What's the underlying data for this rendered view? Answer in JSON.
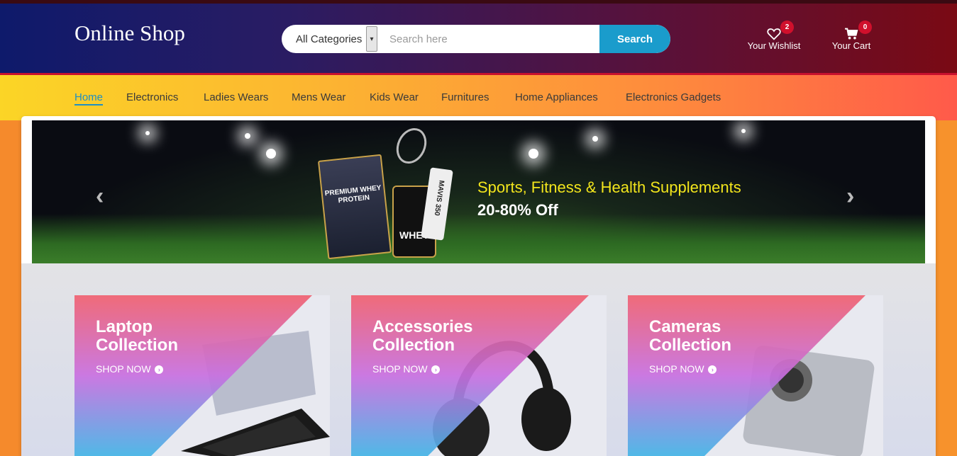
{
  "header": {
    "logo": "Online Shop",
    "search": {
      "category": "All Categories",
      "placeholder": "Search here",
      "button": "Search"
    },
    "wishlist": {
      "label": "Your Wishlist",
      "count": "2"
    },
    "cart": {
      "label": "Your Cart",
      "count": "0"
    }
  },
  "nav": {
    "items": [
      "Home",
      "Electronics",
      "Ladies Wears",
      "Mens Wear",
      "Kids Wear",
      "Furnitures",
      "Home Appliances",
      "Electronics Gadgets"
    ]
  },
  "banner": {
    "title": "Sports, Fitness & Health Supplements",
    "subtitle": "20-80% Off",
    "prev_icon": "chevron-left-icon",
    "next_icon": "chevron-right-icon",
    "product_text": {
      "whey_bag": "PREMIUM WHEY PROTEIN",
      "whey_tub": "WHEY",
      "shuttle_tube": "MAVIS 350"
    }
  },
  "collections": [
    {
      "title_line1": "Laptop",
      "title_line2": "Collection",
      "cta": "SHOP NOW"
    },
    {
      "title_line1": "Accessories",
      "title_line2": "Collection",
      "cta": "SHOP NOW"
    },
    {
      "title_line1": "Cameras",
      "title_line2": "Collection",
      "cta": "SHOP NOW"
    }
  ],
  "colors": {
    "accent": "#1a9ccc",
    "badge": "#d0102c",
    "banner_title": "#f2e51c"
  }
}
